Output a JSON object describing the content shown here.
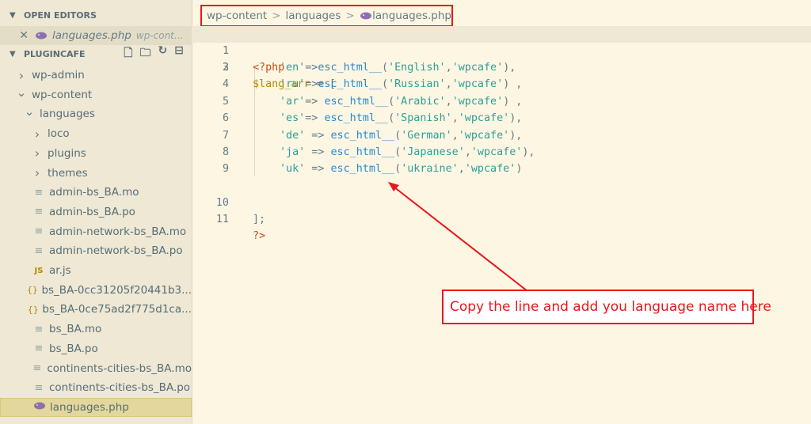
{
  "explorer": {
    "open_editors_label": "OPEN EDITORS",
    "open_editor_file": "languages.php",
    "open_editor_path": "wp-cont...",
    "project_label": "PLUGINCAFE",
    "tree": [
      {
        "label": "wp-admin",
        "kind": "folder",
        "expanded": false
      },
      {
        "label": "wp-content",
        "kind": "folder",
        "expanded": true
      },
      {
        "label": "languages",
        "kind": "folder",
        "expanded": true
      },
      {
        "label": "loco",
        "kind": "folder",
        "expanded": false
      },
      {
        "label": "plugins",
        "kind": "folder",
        "expanded": false
      },
      {
        "label": "themes",
        "kind": "folder",
        "expanded": false
      },
      {
        "label": "admin-bs_BA.mo",
        "kind": "file"
      },
      {
        "label": "admin-bs_BA.po",
        "kind": "file"
      },
      {
        "label": "admin-network-bs_BA.mo",
        "kind": "file"
      },
      {
        "label": "admin-network-bs_BA.po",
        "kind": "file"
      },
      {
        "label": "ar.js",
        "kind": "js",
        "icon_text": "JS"
      },
      {
        "label": "bs_BA-0cc31205f20441b3...",
        "kind": "json",
        "icon_text": "{}"
      },
      {
        "label": "bs_BA-0ce75ad2f775d1ca...",
        "kind": "json",
        "icon_text": "{}"
      },
      {
        "label": "bs_BA.mo",
        "kind": "file"
      },
      {
        "label": "bs_BA.po",
        "kind": "file"
      },
      {
        "label": "continents-cities-bs_BA.mo",
        "kind": "file"
      },
      {
        "label": "continents-cities-bs_BA.po",
        "kind": "file"
      },
      {
        "label": "languages.php",
        "kind": "php",
        "selected": true
      }
    ]
  },
  "breadcrumb": {
    "part1": "wp-content",
    "part2": "languages",
    "part3": "languages.php",
    "separator": ">"
  },
  "code": {
    "line_numbers": [
      "1",
      "2",
      "3",
      "4",
      "5",
      "6",
      "7",
      "8",
      "9",
      "10",
      "11"
    ],
    "l1": "<?php",
    "l2_var": "$lang_arr",
    "l2_rest": " = [",
    "entries": [
      {
        "key": "'en'",
        "op": "=>",
        "fn": "esc_html__",
        "a": "'English'",
        "b": "'wpcafe'",
        "tail": "),"
      },
      {
        "key": "'ru'",
        "op": "=>",
        "fn": "esc_html__",
        "a": "'Russian'",
        "b": "'wpcafe'",
        "tail": ") ,"
      },
      {
        "key": "'ar'",
        "op": "=> ",
        "fn": "esc_html__",
        "a": "'Arabic'",
        "b": "'wpcafe'",
        "tail": ") ,"
      },
      {
        "key": "'es'",
        "op": "=> ",
        "fn": "esc_html__",
        "a": "'Spanish'",
        "b": "'wpcafe'",
        "tail": "),"
      },
      {
        "key": "'de'",
        "op": " => ",
        "fn": "esc_html__",
        "a": "'German'",
        "b": "'wpcafe'",
        "tail": "),"
      },
      {
        "key": "'ja'",
        "op": " => ",
        "fn": "esc_html__",
        "a": "'Japanese'",
        "b": "'wpcafe'",
        "tail": "),"
      },
      {
        "key": "'uk'",
        "op": " => ",
        "fn": "esc_html__",
        "a": "'ukraine'",
        "b": "'wpcafe'",
        "tail": ")"
      }
    ],
    "l10": "];",
    "l11": "?>"
  },
  "annotation": {
    "text": "Copy the line and add you language name here"
  },
  "colors": {
    "accent_red": "#e8171c",
    "sidebar_bg": "#eee8d5",
    "editor_bg": "#fdf6e3"
  }
}
